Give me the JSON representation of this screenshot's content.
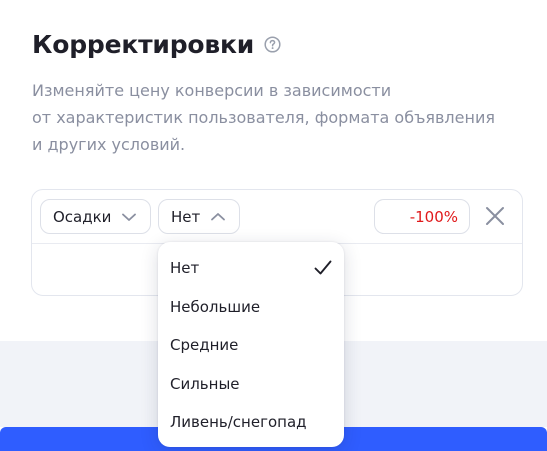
{
  "header": {
    "title": "Корректировки",
    "help_icon": "question-circle-icon",
    "description_lines": [
      "Изменяйте цену конверсии в зависимости",
      "от характеристик пользователя, формата объявления",
      "и других условий."
    ]
  },
  "adjustment": {
    "parameter": "Осадки",
    "value": "Нет",
    "percent": "-100%",
    "remove_icon": "close-icon"
  },
  "dropdown": {
    "options": [
      "Нет",
      "Небольшие",
      "Средние",
      "Сильные",
      "Ливень/снегопад"
    ],
    "selected": "Нет",
    "check_icon": "check-icon"
  },
  "colors": {
    "accent_blue": "#2f5dff",
    "negative_red": "#e0191b",
    "text_muted": "#8a8fa0"
  }
}
